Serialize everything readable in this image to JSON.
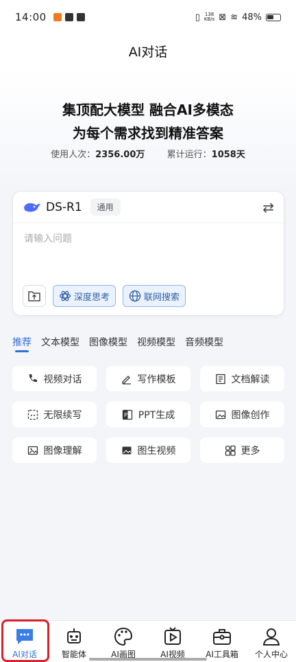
{
  "status_bar": {
    "time": "14:00",
    "net_speed_top": "138",
    "net_speed_bottom": "KB/s",
    "battery": "48%"
  },
  "header": {
    "title": "AI对话"
  },
  "hero": {
    "line1": "集顶配大模型 融合AI多模态",
    "line2": "为每个需求找到精准答案",
    "stats": {
      "users_label": "使用人次：",
      "users_value": "2356.00万",
      "run_label": "累计运行：",
      "run_value": "1058天"
    }
  },
  "chat_card": {
    "model_name": "DS-R1",
    "model_tag": "通用",
    "input_placeholder": "请输入问题",
    "btn_deep": "深度思考",
    "btn_web": "联网搜索",
    "accent": "#2f5fa8"
  },
  "tabs": [
    {
      "label": "推荐",
      "active": true
    },
    {
      "label": "文本模型"
    },
    {
      "label": "图像模型"
    },
    {
      "label": "视频模型"
    },
    {
      "label": "音频模型"
    }
  ],
  "features": [
    {
      "label": "视频对话",
      "icon": "phone-icon"
    },
    {
      "label": "写作模板",
      "icon": "pen-icon"
    },
    {
      "label": "文档解读",
      "icon": "document-icon"
    },
    {
      "label": "无限续写",
      "icon": "infinite-write-icon"
    },
    {
      "label": "PPT生成",
      "icon": "ppt-icon"
    },
    {
      "label": "图像创作",
      "icon": "image-create-icon"
    },
    {
      "label": "图像理解",
      "icon": "image-understand-icon"
    },
    {
      "label": "图生视频",
      "icon": "image-to-video-icon"
    },
    {
      "label": "更多",
      "icon": "more-grid-icon"
    }
  ],
  "bottom_nav": [
    {
      "label": "AI对话",
      "icon": "chat-bubble-icon",
      "active": true
    },
    {
      "label": "智能体",
      "icon": "robot-icon"
    },
    {
      "label": "AI画图",
      "icon": "palette-icon"
    },
    {
      "label": "AI视频",
      "icon": "video-play-icon"
    },
    {
      "label": "AI工具箱",
      "icon": "toolbox-icon"
    },
    {
      "label": "个人中心",
      "icon": "user-icon"
    }
  ]
}
